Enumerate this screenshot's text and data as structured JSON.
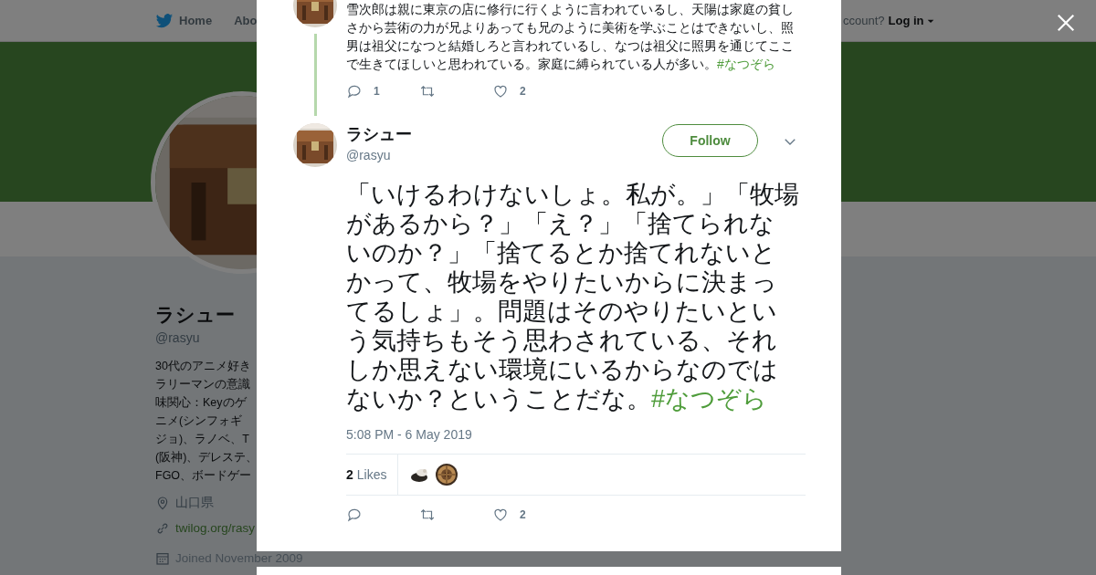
{
  "nav": {
    "items": [
      "Home",
      "Abo"
    ],
    "account_prompt": "ccount?",
    "login": "Log in"
  },
  "profile": {
    "name": "ラシュー",
    "handle": "@rasyu",
    "bio_lines": [
      "30代のアニメ好き",
      "ラリーマンの意識",
      "味関心：Keyのゲ",
      "ニメ(シンフォギ",
      "ジョ)、ラノベ、T",
      "(阪神)、デレステ、",
      "FGO、ボードゲー"
    ],
    "location": "山口県",
    "website": "twilog.org/rasy",
    "joined": "Joined November 2009"
  },
  "parent_tweet": {
    "text": "雪次郎は親に東京の店に修行に行くように言われているし、天陽は家庭の貧しさから芸術の力が兄よりあっても兄のように美術を学ぶことはできないし、照男は祖父になつと結婚しろと言われているし、なつは祖父に照男を通じてここで生きてほしいと思われている。家庭に縛られている人が多い。",
    "hashtag": "#なつぞら",
    "replies": "1",
    "likes": "2"
  },
  "tweet": {
    "name": "ラシュー",
    "handle": "@rasyu",
    "follow": "Follow",
    "text": "「いけるわけないしょ。私が。」「牧場があるから？」「え？」「捨てられないのか？」「捨てるとか捨てれないとかって、牧場をやりたいからに決まってるしょ」。問題はそのやりたいという気持ちもそう思わされている、それしか思えない環境にいるからなのではないか？ということだな。",
    "hashtag": "#なつぞら",
    "timestamp": "5:08 PM - 6 May 2019",
    "likes_count": "2",
    "likes_label": "Likes",
    "likes": "2"
  }
}
